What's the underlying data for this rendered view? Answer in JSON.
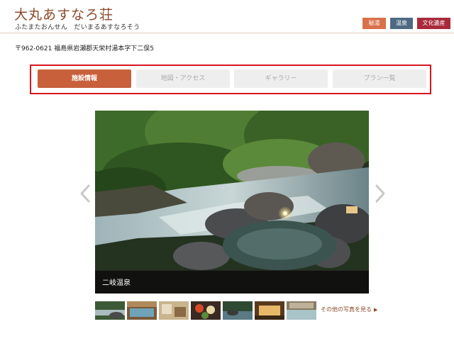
{
  "header": {
    "title": "大丸あすなろ荘",
    "subtitle": "ふたまたおんせん　だいまるあすなろそう",
    "badges": [
      {
        "label": "秘湯",
        "color": "#d9714b"
      },
      {
        "label": "温泉",
        "color": "#4d6a82"
      },
      {
        "label": "文化遺産",
        "color": "#a82a3a"
      }
    ]
  },
  "address": "〒962-0621 福島県岩瀬郡天栄村湯本字下二俣5",
  "tabs": [
    {
      "label": "施設情報",
      "active": true
    },
    {
      "label": "地図・アクセス",
      "active": false
    },
    {
      "label": "ギャラリー",
      "active": false
    },
    {
      "label": "プラン一覧",
      "active": false
    }
  ],
  "colors": {
    "accent": "#c9603c",
    "tab_highlight_border": "#d8161f",
    "title_brown": "#8a4a2a"
  },
  "slider": {
    "caption": "二岐温泉",
    "prev_icon": "chevron-left-icon",
    "next_icon": "chevron-right-icon"
  },
  "thumbnails": [
    {
      "alt": "river-thumbnail"
    },
    {
      "alt": "bath-thumbnail"
    },
    {
      "alt": "room-thumbnail"
    },
    {
      "alt": "meal-thumbnail"
    },
    {
      "alt": "outdoor-bath-thumbnail"
    },
    {
      "alt": "lobby-thumbnail"
    },
    {
      "alt": "indoor-bath-thumbnail"
    }
  ],
  "more_photos_link": "その他の写真を見る"
}
